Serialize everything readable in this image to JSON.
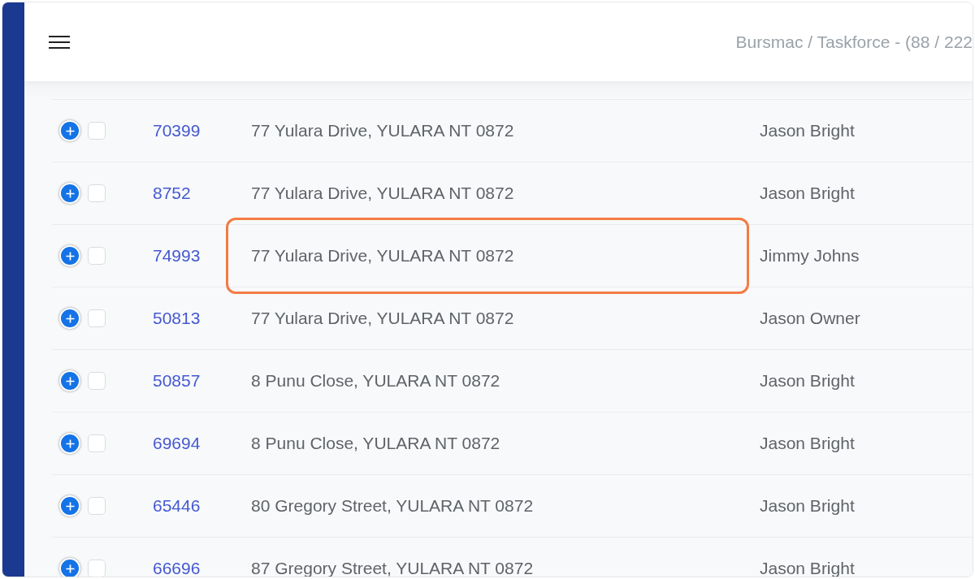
{
  "header": {
    "title": "Bursmac / Taskforce - (88 / 222"
  },
  "rows": [
    {
      "id": "70399",
      "address": "77 Yulara Drive, YULARA NT 0872",
      "owner": "Jason Bright",
      "checked": false,
      "highlighted": false
    },
    {
      "id": "8752",
      "address": "77 Yulara Drive, YULARA NT 0872",
      "owner": "Jason Bright",
      "checked": false,
      "highlighted": false
    },
    {
      "id": "74993",
      "address": "77 Yulara Drive, YULARA NT 0872",
      "owner": "Jimmy Johns",
      "checked": false,
      "highlighted": true
    },
    {
      "id": "50813",
      "address": "77 Yulara Drive, YULARA NT 0872",
      "owner": "Jason Owner",
      "checked": false,
      "highlighted": false
    },
    {
      "id": "50857",
      "address": "8 Punu Close, YULARA NT 0872",
      "owner": "Jason Bright",
      "checked": false,
      "highlighted": false
    },
    {
      "id": "69694",
      "address": "8 Punu Close, YULARA NT 0872",
      "owner": "Jason Bright",
      "checked": false,
      "highlighted": false
    },
    {
      "id": "65446",
      "address": "80 Gregory Street, YULARA NT 0872",
      "owner": "Jason Bright",
      "checked": false,
      "highlighted": false
    },
    {
      "id": "66696",
      "address": "87 Gregory Street, YULARA NT 0872",
      "owner": "Jason Bright",
      "checked": false,
      "highlighted": false
    }
  ]
}
